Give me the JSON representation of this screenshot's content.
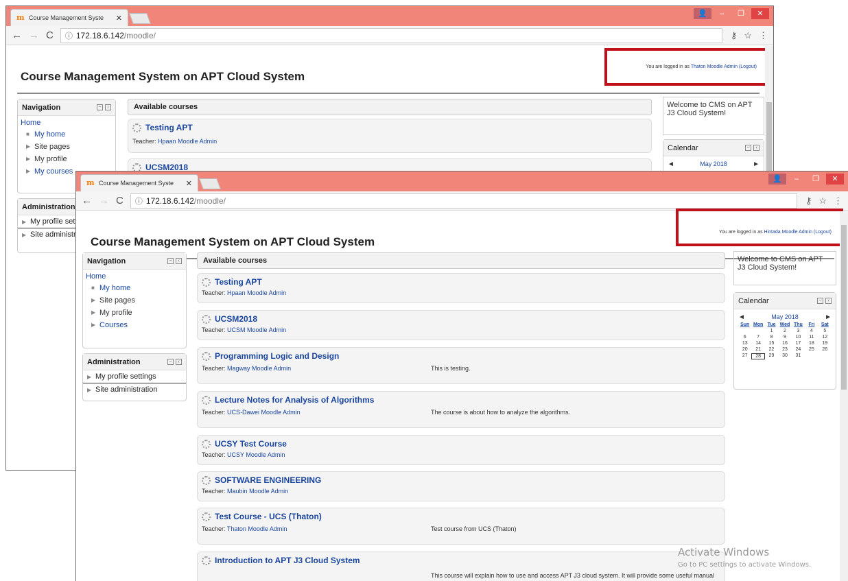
{
  "back_window": {
    "tab_title": "Course Management Syste",
    "url_host": "172.18.6.142",
    "url_path": "/moodle/",
    "site_title": "Course Management System on APT Cloud System",
    "login_prefix": "You are logged in as",
    "login_user": "Thaton Moodle Admin",
    "logout": "(Logout)",
    "navigation": {
      "title": "Navigation",
      "home": "Home",
      "items": [
        "My home",
        "Site pages",
        "My profile",
        "My courses"
      ]
    },
    "administration": {
      "title": "Administration",
      "items": [
        "My profile setti",
        "Site administra"
      ]
    },
    "available_courses": "Available courses",
    "courses": [
      {
        "name": "Testing APT",
        "teacher_label": "Teacher:",
        "teacher": "Hpaan Moodle Admin"
      },
      {
        "name": "UCSM2018"
      }
    ],
    "welcome": "Welcome to CMS on APT J3 Cloud System!",
    "calendar_title": "Calendar",
    "calendar_month": "May 2018"
  },
  "front_window": {
    "tab_title": "Course Management Syste",
    "url_host": "172.18.6.142",
    "url_path": "/moodle/",
    "site_title": "Course Management System on APT Cloud System",
    "login_prefix": "You are logged in as",
    "login_user": "Hintada Moodle Admin",
    "logout": "(Logout)",
    "navigation": {
      "title": "Navigation",
      "home": "Home",
      "items": [
        "My home",
        "Site pages",
        "My profile",
        "Courses"
      ]
    },
    "administration": {
      "title": "Administration",
      "items": [
        "My profile settings",
        "Site administration"
      ]
    },
    "available_courses": "Available courses",
    "courses": [
      {
        "name": "Testing APT",
        "teacher_label": "Teacher:",
        "teacher": "Hpaan Moodle Admin",
        "summary": ""
      },
      {
        "name": "UCSM2018",
        "teacher_label": "Teacher:",
        "teacher": "UCSM Moodle Admin",
        "summary": ""
      },
      {
        "name": "Programming Logic and Design",
        "teacher_label": "Teacher:",
        "teacher": "Magway Moodle Admin",
        "summary": "This is testing."
      },
      {
        "name": "Lecture Notes for Analysis of Algorithms",
        "teacher_label": "Teacher:",
        "teacher": "UCS-Dawei Moodle Admin",
        "summary": "The course is about how to analyze the algorithms."
      },
      {
        "name": "UCSY Test Course",
        "teacher_label": "Teacher:",
        "teacher": "UCSY Moodle Admin",
        "summary": ""
      },
      {
        "name": "SOFTWARE ENGINEERING",
        "teacher_label": "Teacher:",
        "teacher": "Maubin Moodle Admin",
        "summary": ""
      },
      {
        "name": "Test Course - UCS (Thaton)",
        "teacher_label": "Teacher:",
        "teacher": "Thaton Moodle Admin",
        "summary": "Test course from UCS (Thaton)"
      },
      {
        "name": "Introduction to APT J3 Cloud System",
        "teacher_label": "",
        "teacher": "",
        "summary": "This course will explain how to use and access APT J3 cloud system. It will provide some useful manual"
      }
    ],
    "welcome": "Welcome to CMS on APT J3 Cloud System!",
    "calendar": {
      "title": "Calendar",
      "month": "May 2018",
      "prev": "◄",
      "next": "►",
      "day_headers": [
        "Sun",
        "Mon",
        "Tue",
        "Wed",
        "Thu",
        "Fri",
        "Sat"
      ],
      "cells": [
        "",
        "",
        "1",
        "2",
        "3",
        "4",
        "5",
        "6",
        "7",
        "8",
        "9",
        "10",
        "11",
        "12",
        "13",
        "14",
        "15",
        "16",
        "17",
        "18",
        "19",
        "20",
        "21",
        "22",
        "23",
        "24",
        "25",
        "26",
        "27",
        "28",
        "29",
        "30",
        "31",
        "",
        ""
      ],
      "today": "28"
    }
  },
  "watermark": {
    "title": "Activate Windows",
    "subtitle": "Go to PC settings to activate Windows."
  },
  "colors": {
    "titlebar": "#f2857a",
    "link": "#1a46a0",
    "highlight_box": "#c0101a"
  }
}
